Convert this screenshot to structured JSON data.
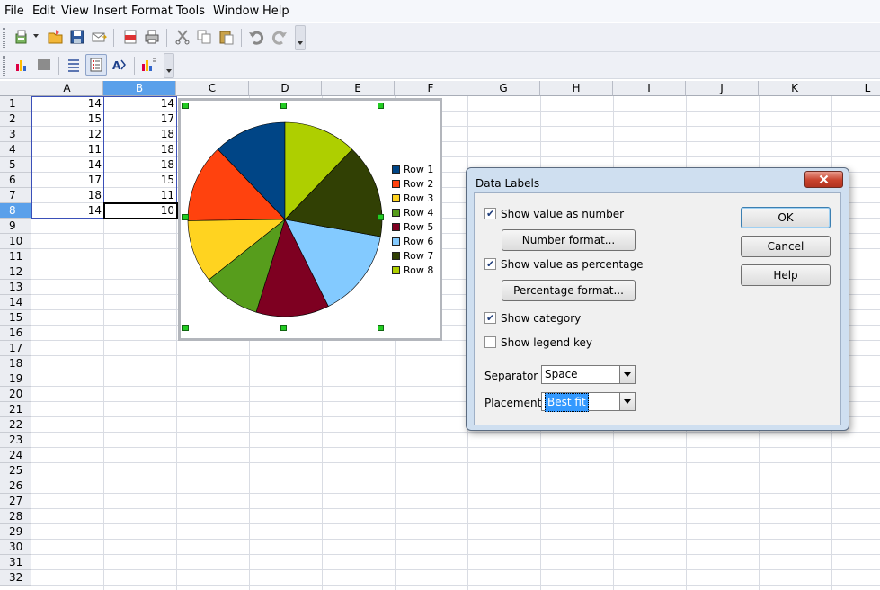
{
  "menu": [
    "File",
    "Edit",
    "View",
    "Insert",
    "Format",
    "Tools",
    "Window",
    "Help"
  ],
  "columns": [
    "A",
    "B",
    "C",
    "D",
    "E",
    "F",
    "G",
    "H",
    "I",
    "J",
    "K",
    "L"
  ],
  "rows": [
    "1",
    "2",
    "3",
    "4",
    "5",
    "6",
    "7",
    "8",
    "9",
    "10",
    "11",
    "12",
    "13",
    "14",
    "15",
    "16",
    "17",
    "18",
    "19",
    "20",
    "21",
    "22",
    "23",
    "24",
    "25",
    "26",
    "27",
    "28",
    "29",
    "30",
    "31",
    "32"
  ],
  "selected_column": "B",
  "selected_row": "8",
  "cells": {
    "A": [
      "14",
      "15",
      "12",
      "11",
      "14",
      "17",
      "18",
      "14"
    ],
    "B": [
      "14",
      "17",
      "18",
      "18",
      "18",
      "15",
      "11",
      "10"
    ]
  },
  "chart_data": {
    "type": "pie",
    "labels": [
      "Row 1",
      "Row 2",
      "Row 3",
      "Row 4",
      "Row 5",
      "Row 6",
      "Row 7",
      "Row 8"
    ],
    "values": [
      14,
      15,
      12,
      11,
      14,
      17,
      18,
      14
    ],
    "colors": [
      "#004586",
      "#ff420e",
      "#ffd320",
      "#579d1c",
      "#7e0021",
      "#83caff",
      "#314004",
      "#aecf00"
    ],
    "legend_position": "right"
  },
  "dialog": {
    "title": "Data Labels",
    "show_value_as_number": {
      "label": "Show value as number",
      "checked": true
    },
    "number_format_button": "Number format...",
    "show_value_as_percentage": {
      "label": "Show value as percentage",
      "checked": true
    },
    "percentage_format_button": "Percentage format...",
    "show_category": {
      "label": "Show category",
      "checked": true
    },
    "show_legend_key": {
      "label": "Show legend key",
      "checked": false
    },
    "separator_label": "Separator",
    "separator_value": "Space",
    "placement_label": "Placement",
    "placement_value": "Best fit",
    "ok_button": "OK",
    "cancel_button": "Cancel",
    "help_button": "Help"
  }
}
